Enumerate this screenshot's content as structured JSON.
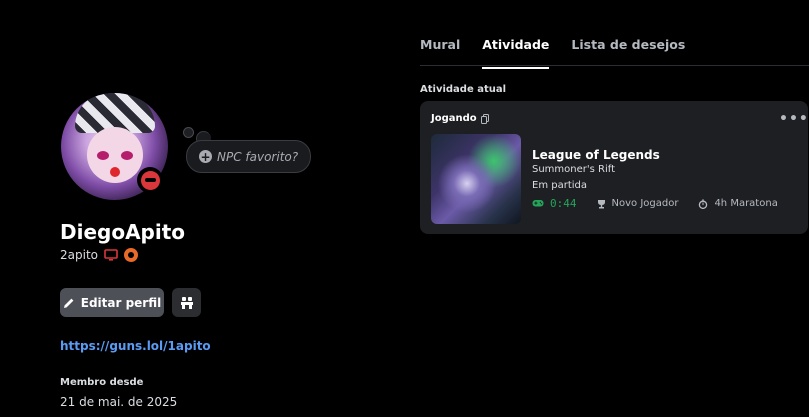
{
  "profile": {
    "display_name": "DiegoApito",
    "username": "2apito",
    "npc_bubble": "NPC favorito?",
    "edit_button": "Editar perfil",
    "link": "https://guns.lol/1apito",
    "member_since_label": "Membro desde",
    "member_since_date": "21 de mai. de 2025",
    "status": "do-not-disturb"
  },
  "tabs": [
    {
      "label": "Mural",
      "active": false
    },
    {
      "label": "Atividade",
      "active": true
    },
    {
      "label": "Lista de desejos",
      "active": false
    }
  ],
  "activity": {
    "section_label": "Atividade atual",
    "header": "Jogando",
    "game_title": "League of Legends",
    "line1": "Summoner's Rift",
    "line2": "Em partida",
    "timer": "0:44",
    "tag1": "Novo Jogador",
    "tag2": "4h Maratona"
  },
  "colors": {
    "background": "#000000",
    "card": "#1e1f22",
    "link": "#5b9bf3",
    "dnd": "#da373c",
    "timer": "#23a55a",
    "nitro": "#e86a2a"
  },
  "icons": [
    "pencil-icon",
    "nitro-shop-icon",
    "monitor-icon",
    "plus-circle-icon",
    "copy-icon",
    "more-icon",
    "gamepad-icon",
    "trophy-icon",
    "stopwatch-icon"
  ]
}
